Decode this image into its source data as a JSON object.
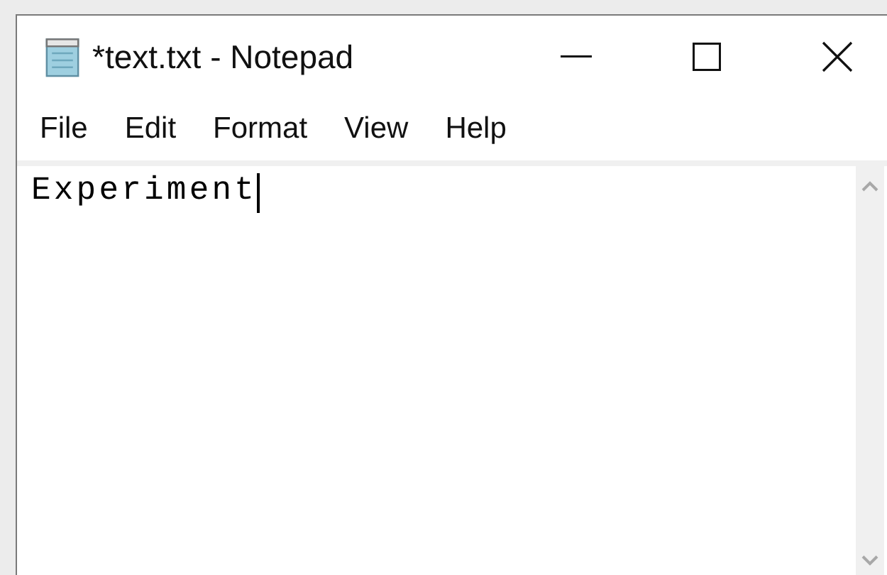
{
  "window": {
    "title": "*text.txt - Notepad"
  },
  "menu": [
    "File",
    "Edit",
    "Format",
    "View",
    "Help"
  ],
  "editor": {
    "text": "Experiment"
  }
}
